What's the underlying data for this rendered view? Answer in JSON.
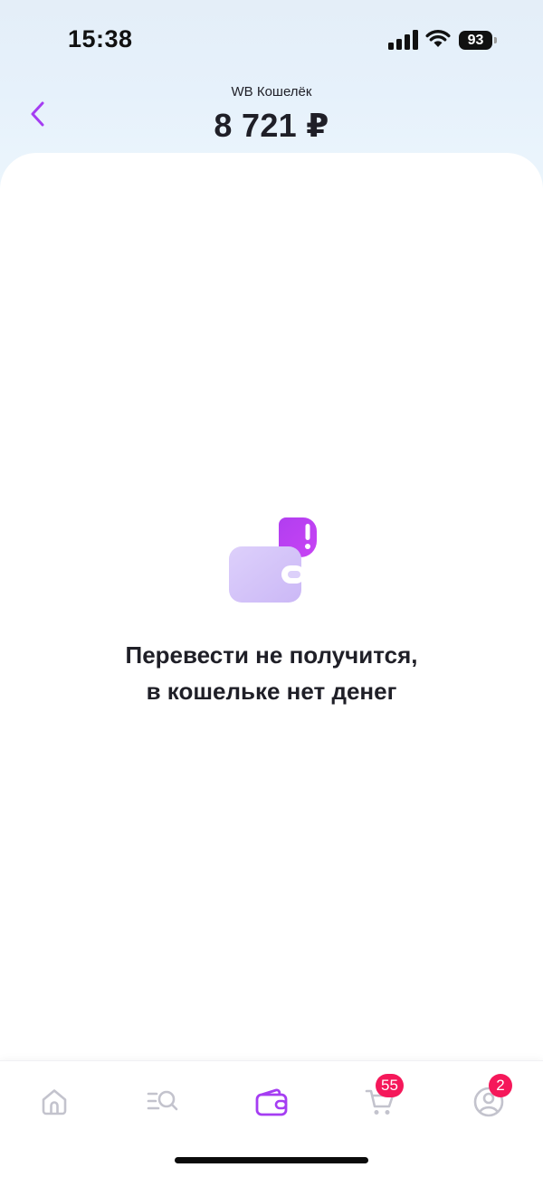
{
  "status_bar": {
    "time": "15:38",
    "battery": "93"
  },
  "header": {
    "title": "WB Кошелёк",
    "balance": "8 721 ₽",
    "back_icon": "chevron-left-icon"
  },
  "empty_state": {
    "icon": "wallet-alert-icon",
    "line1": "Перевести не получится,",
    "line2": "в кошельке нет денег"
  },
  "tab_bar": {
    "tabs": [
      {
        "icon": "home-icon",
        "badge": ""
      },
      {
        "icon": "catalog-search-icon",
        "badge": ""
      },
      {
        "icon": "wallet-icon",
        "badge": "",
        "active": true
      },
      {
        "icon": "cart-icon",
        "badge": "55"
      },
      {
        "icon": "profile-icon",
        "badge": "2"
      }
    ]
  },
  "colors": {
    "accent": "#a53df2",
    "badge": "#f5185a",
    "inactive_icon": "#c3c3cd",
    "text": "#1f1f27"
  }
}
